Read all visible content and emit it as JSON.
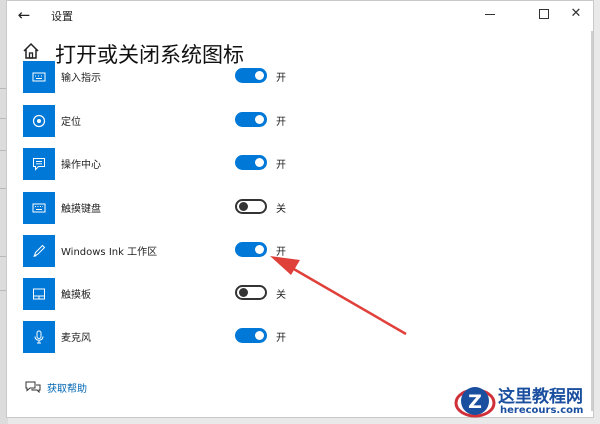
{
  "window": {
    "title": "设置",
    "back_icon": "back-arrow-icon",
    "min_icon": "minimize-icon",
    "max_icon": "maximize-icon",
    "close_icon": "close-icon",
    "close_glyph": "✕",
    "back_glyph": "←"
  },
  "page": {
    "title": "打开或关闭系统图标",
    "home_icon": "home-icon"
  },
  "items": [
    {
      "label": "输入指示",
      "icon": "keyboard-indicator-icon",
      "on": true,
      "state": "开"
    },
    {
      "label": "定位",
      "icon": "location-icon",
      "on": true,
      "state": "开"
    },
    {
      "label": "操作中心",
      "icon": "action-center-icon",
      "on": true,
      "state": "开"
    },
    {
      "label": "触摸键盘",
      "icon": "touch-keyboard-icon",
      "on": false,
      "state": "关"
    },
    {
      "label": "Windows Ink 工作区",
      "icon": "pen-icon",
      "on": true,
      "state": "开"
    },
    {
      "label": "触摸板",
      "icon": "touchpad-icon",
      "on": false,
      "state": "关"
    },
    {
      "label": "麦克风",
      "icon": "microphone-icon",
      "on": true,
      "state": "开"
    }
  ],
  "help": {
    "label": "获取帮助",
    "icon": "help-chat-icon"
  },
  "watermark": {
    "title": "这里教程网",
    "url": "herecours.com",
    "logo_letter": "Z"
  },
  "colors": {
    "accent": "#0078d7",
    "arrow": "#e0403a",
    "link": "#0066b4",
    "watermark": "#1a4fa0"
  }
}
